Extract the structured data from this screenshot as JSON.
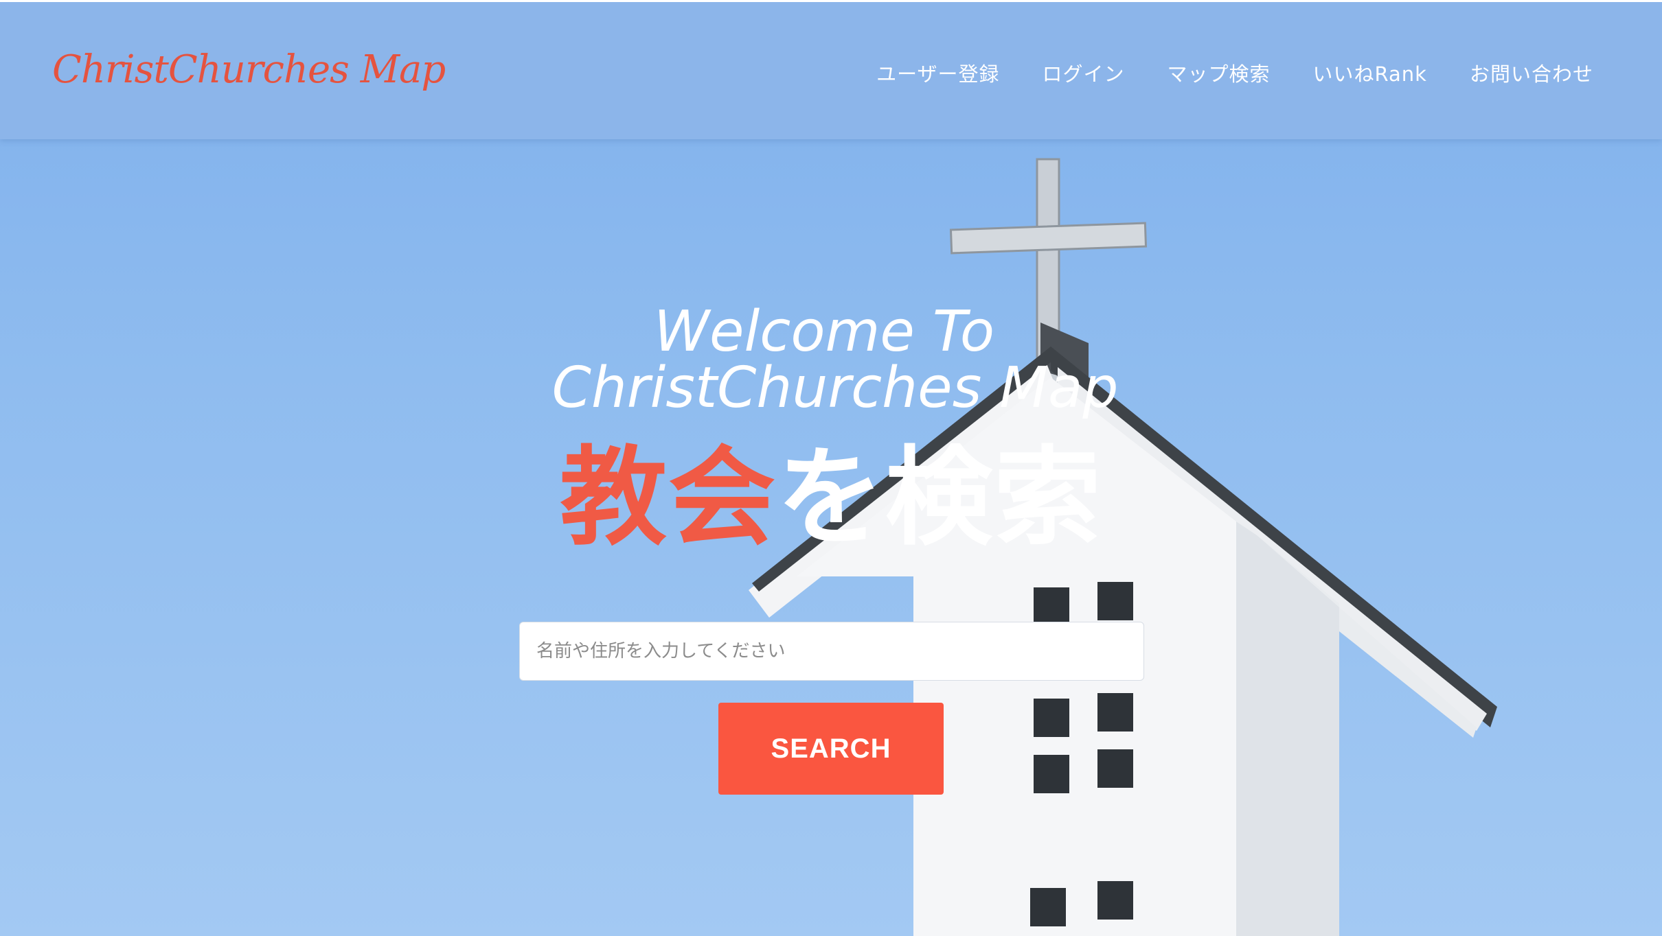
{
  "header": {
    "logo": "ChristChurches Map",
    "nav": [
      {
        "label": "ユーザー登録"
      },
      {
        "label": "ログイン"
      },
      {
        "label": "マップ検索"
      },
      {
        "label": "いいねRank"
      },
      {
        "label": "お問い合わせ"
      }
    ]
  },
  "hero": {
    "welcome_line1": "Welcome To",
    "welcome_line2": "ChristChurches Map",
    "headline_accent": "教会",
    "headline_rest": "を検索",
    "search_placeholder": "名前や住所を入力してください",
    "search_button": "SEARCH"
  },
  "colors": {
    "accent": "#f05a45",
    "button": "#fa5640",
    "header_bg": "#8cb5e9",
    "sky": "#8fbcef"
  }
}
